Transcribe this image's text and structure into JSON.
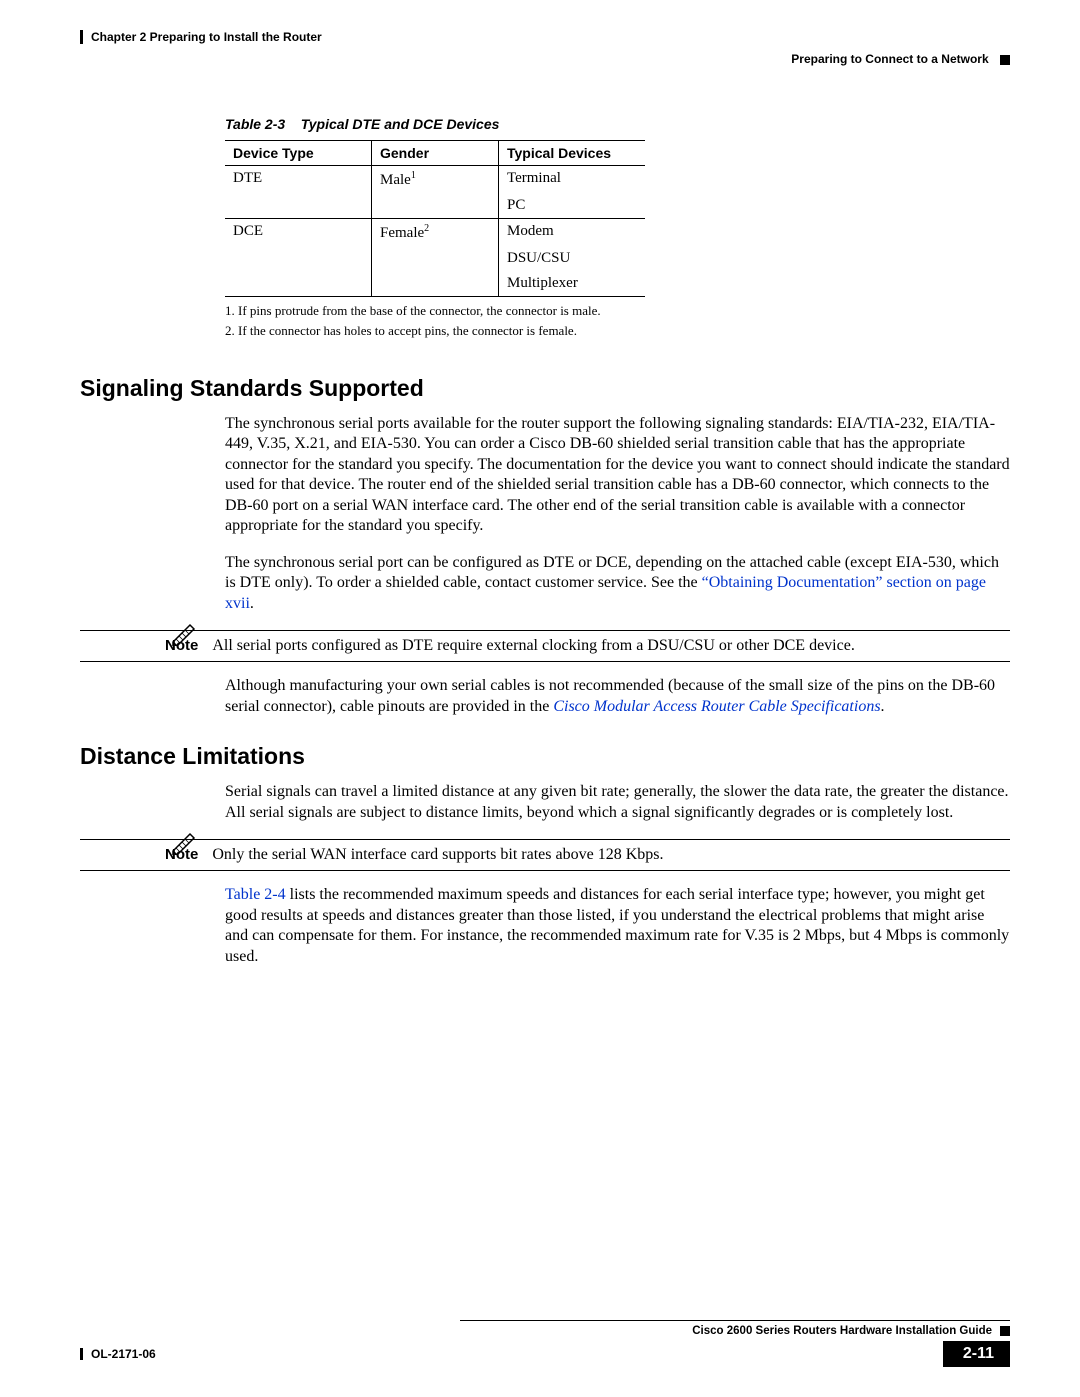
{
  "header": {
    "chapter": "Chapter 2      Preparing to Install the Router",
    "section": "Preparing to Connect to a Network"
  },
  "table_caption": {
    "label": "Table 2-3",
    "title": "Typical DTE and DCE Devices"
  },
  "table": {
    "headers": [
      "Device Type",
      "Gender",
      "Typical Devices"
    ],
    "rows": [
      {
        "c0": "DTE",
        "c1": "Male",
        "sup": "1",
        "c2": "Terminal"
      },
      {
        "c0": "",
        "c1": "",
        "sup": "",
        "c2": "PC"
      },
      {
        "c0": "DCE",
        "c1": "Female",
        "sup": "2",
        "c2": "Modem"
      },
      {
        "c0": "",
        "c1": "",
        "sup": "",
        "c2": "DSU/CSU"
      },
      {
        "c0": "",
        "c1": "",
        "sup": "",
        "c2": "Multiplexer"
      }
    ]
  },
  "table_notes": {
    "n1": "1.   If pins protrude from the base of the connector, the connector is male.",
    "n2": "2.   If the connector has holes to accept pins, the connector is female."
  },
  "sec1": {
    "heading": "Signaling Standards Supported",
    "p1": "The synchronous serial ports available for the router support the following signaling standards: EIA/TIA-232, EIA/TIA-449, V.35, X.21, and EIA-530. You can order a Cisco DB-60 shielded serial transition cable that has the appropriate connector for the standard you specify. The documentation for the device you want to connect should indicate the standard used for that device. The router end of the shielded serial transition cable has a DB-60 connector, which connects to the DB-60 port on a serial WAN interface card. The other end of the serial transition cable is available with a connector appropriate for the standard you specify.",
    "p2a": "The synchronous serial port can be configured as DTE or DCE, depending on the attached cable (except EIA-530, which is DTE only). To order a shielded cable, contact customer service. See the ",
    "p2link": "“Obtaining Documentation” section on page xvii",
    "p2b": ".",
    "note_label": "Note",
    "note_text": "All serial ports configured as DTE require external clocking from a DSU/CSU or other DCE device.",
    "p3a": "Although manufacturing your own serial cables is not recommended (because of the small size of the pins on the DB-60 serial connector), cable pinouts are provided in the ",
    "p3link": "Cisco Modular Access Router Cable Specifications",
    "p3b": "."
  },
  "sec2": {
    "heading": "Distance Limitations",
    "p1": "Serial signals can travel a limited distance at any given bit rate; generally, the slower the data rate, the greater the distance. All serial signals are subject to distance limits, beyond which a signal significantly degrades or is completely lost.",
    "note_label": "Note",
    "note_text": "Only the serial WAN interface card supports bit rates above 128 Kbps.",
    "p2link": "Table 2-4",
    "p2": " lists the recommended maximum speeds and distances for each serial interface type; however, you might get good results at speeds and distances greater than those listed, if you understand the electrical problems that might arise and can compensate for them. For instance, the recommended maximum rate for V.35 is 2 Mbps, but 4 Mbps is commonly used."
  },
  "footer": {
    "guide": "Cisco 2600 Series Routers Hardware Installation Guide",
    "doc_id": "OL-2171-06",
    "page": "2-11"
  }
}
